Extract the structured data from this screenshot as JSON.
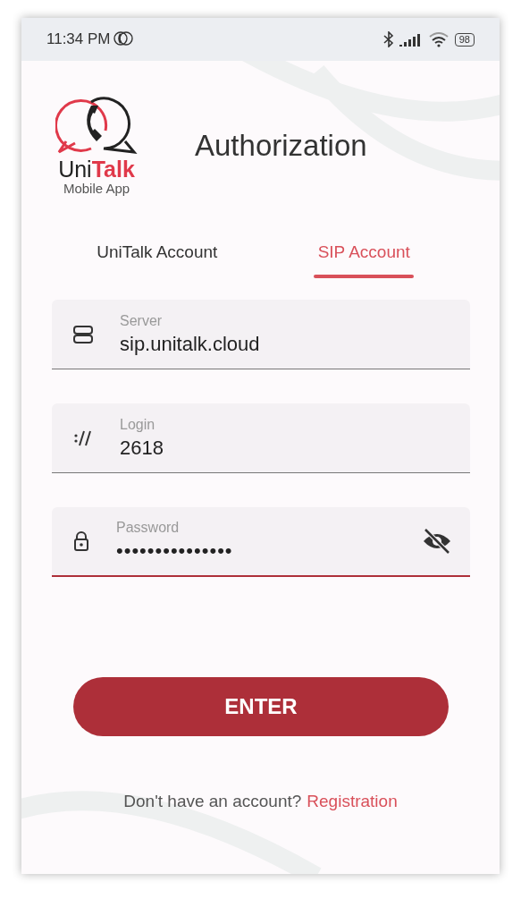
{
  "status_bar": {
    "time": "11:34 PM",
    "battery": "98"
  },
  "logo": {
    "brand_first": "Uni",
    "brand_second": "Talk",
    "subtitle": "Mobile App"
  },
  "title": "Authorization",
  "tabs": [
    {
      "label": "UniTalk Account",
      "selected": false
    },
    {
      "label": "SIP Account",
      "selected": true
    }
  ],
  "fields": [
    {
      "kind": "server",
      "label": "Server",
      "value": "sip.unitalk.cloud",
      "focused": false
    },
    {
      "kind": "login",
      "label": "Login",
      "value": "2618",
      "focused": false
    },
    {
      "kind": "password",
      "label": "Password",
      "value": "•••••••••••••••",
      "focused": true,
      "revealed": false
    }
  ],
  "enter_button": "ENTER",
  "footer": {
    "prompt": "Don't have an account?",
    "link": "Registration"
  }
}
